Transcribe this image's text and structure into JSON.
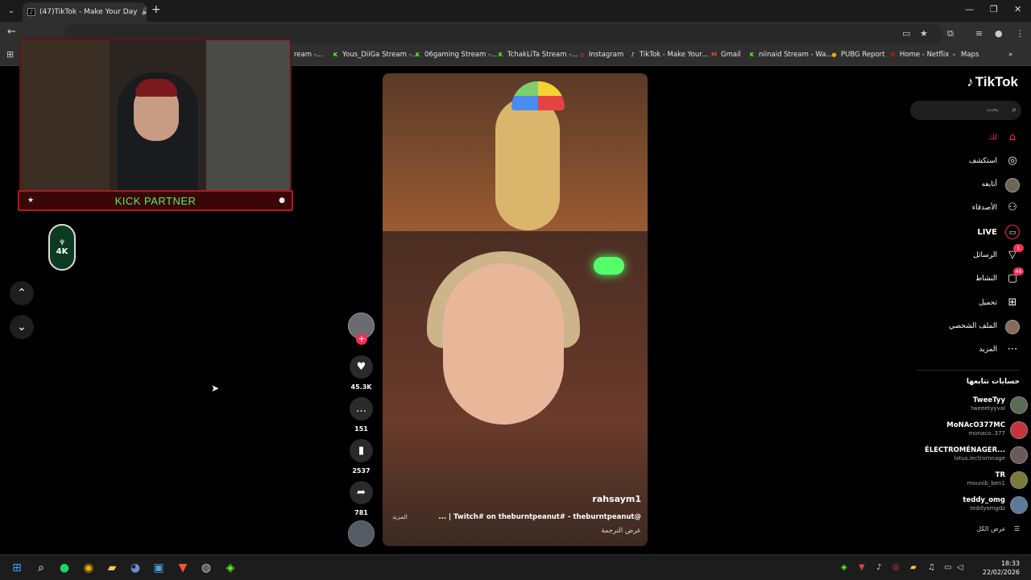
{
  "browser": {
    "tab_title": "(47)TikTok - Make Your Day",
    "tab_close": "✕",
    "new_tab": "+",
    "window_controls": [
      "—",
      "❐",
      "✕"
    ],
    "bookmarks": [
      {
        "label": "ream -...",
        "icon": "kick-icon",
        "color": "#53fc18"
      },
      {
        "label": "Yous_DiiGa Stream -...",
        "icon": "kick-icon",
        "color": "#53fc18"
      },
      {
        "label": "06gaming Stream -...",
        "icon": "kick-icon",
        "color": "#53fc18"
      },
      {
        "label": "TchakLiTa Stream -...",
        "icon": "kick-icon",
        "color": "#53fc18"
      },
      {
        "label": "Instagram",
        "icon": "instagram-icon",
        "color": "#e1306c"
      },
      {
        "label": "TikTok - Make Your...",
        "icon": "tiktok-icon",
        "color": "#ffffff"
      },
      {
        "label": "Gmail",
        "icon": "gmail-icon",
        "color": "#ea4335"
      },
      {
        "label": "niinaid Stream - Wa...",
        "icon": "kick-icon",
        "color": "#53fc18"
      },
      {
        "label": "PUBG Report",
        "icon": "pubg-icon",
        "color": "#f2a900"
      },
      {
        "label": "Home - Netflix",
        "icon": "netflix-icon",
        "color": "#e50914"
      },
      {
        "label": "Maps",
        "icon": "maps-icon",
        "color": "#34a853"
      }
    ]
  },
  "overlay": {
    "kick_label": "KICK PARTNER",
    "badge_text": "4K"
  },
  "video": {
    "author": "rahsaym1",
    "caption": "... | Twitch# on theburntpeanut# - theburntpeanut@",
    "more": "المزيد",
    "translate": "عرض الترجمة"
  },
  "actions": {
    "likes": "45.3K",
    "comments": "151",
    "saves": "2537",
    "shares": "781"
  },
  "sidebar": {
    "logo": "TikTok",
    "search_placeholder": "بحث",
    "nav": [
      {
        "label": "لك",
        "icon": "home-icon"
      },
      {
        "label": "استكشف",
        "icon": "compass-icon"
      },
      {
        "label": "أتابعه",
        "icon": "following-avatar-icon"
      },
      {
        "label": "الأصدقاء",
        "icon": "friends-icon"
      },
      {
        "label": "LIVE",
        "icon": "live-icon"
      },
      {
        "label": "الرسائل",
        "icon": "messages-icon",
        "badge": "1"
      },
      {
        "label": "النشاط",
        "icon": "activity-icon",
        "badge": "46"
      },
      {
        "label": "تحميل",
        "icon": "upload-icon"
      },
      {
        "label": "الملف الشخصي",
        "icon": "profile-avatar-icon"
      },
      {
        "label": "المزيد",
        "icon": "more-icon"
      }
    ],
    "following_title": "حسابات تتابعها",
    "following": [
      {
        "name": "TweeTyy",
        "handle": "tweeetyyval"
      },
      {
        "name": "MoNAcO377MC",
        "handle": "monaco..377"
      },
      {
        "name": "ÉLECTROMÉNAGER...",
        "handle": "lotus.lectromnage"
      },
      {
        "name": "TR",
        "handle": "mounib_ben1"
      },
      {
        "name": "teddy_omg",
        "handle": "teddyomgdz"
      }
    ],
    "see_all": "عرض الكل"
  },
  "taskbar": {
    "time": "18:33",
    "date": "22/02/2026"
  }
}
